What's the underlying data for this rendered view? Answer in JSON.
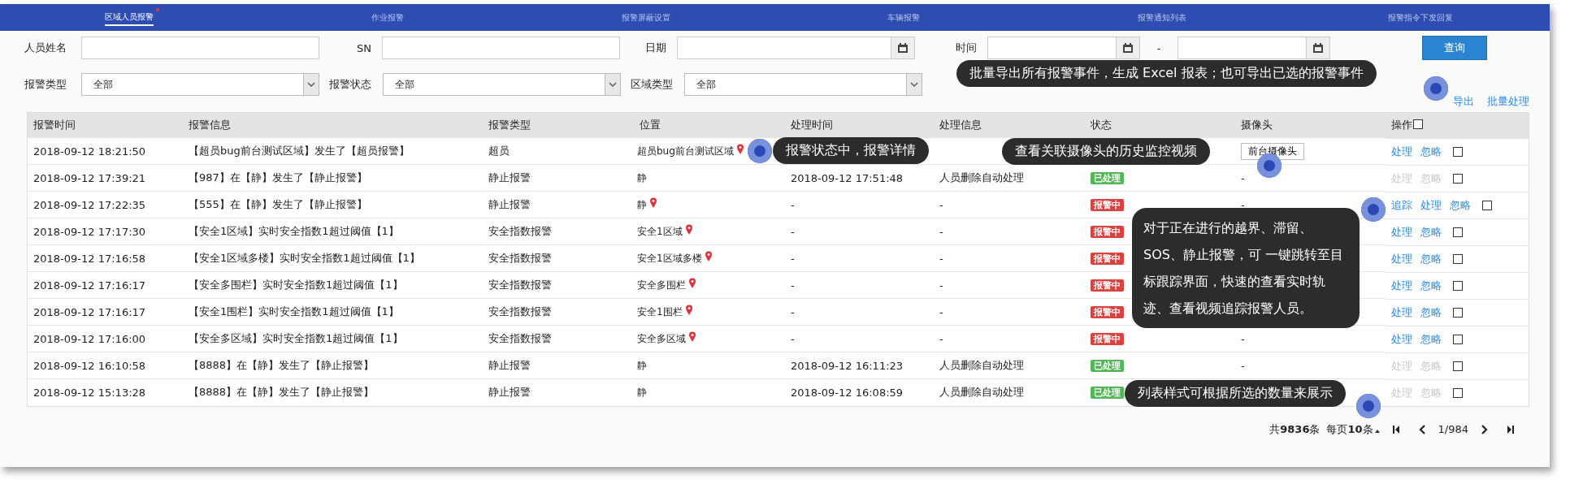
{
  "nav_tabs": [
    {
      "label": "区域人员报警",
      "selected": true,
      "dot": true
    },
    {
      "label": "作业报警",
      "selected": false,
      "dot": false
    },
    {
      "label": "报警屏蔽设置",
      "selected": false,
      "dot": false
    },
    {
      "label": "车辆报警",
      "selected": false,
      "dot": false
    },
    {
      "label": "报警通知列表",
      "selected": false,
      "dot": false
    },
    {
      "label": "报警指令下发回复",
      "selected": false,
      "dot": false
    }
  ],
  "filters": [
    {
      "kind": "text",
      "label": "人员姓名"
    },
    {
      "kind": "text",
      "label": "SN"
    },
    {
      "kind": "date",
      "label": "日期"
    },
    {
      "kind": "range",
      "label": "时间",
      "separator": "-"
    }
  ],
  "search_button": "查询",
  "selects": [
    {
      "label": "报警类型",
      "value": "全部"
    },
    {
      "label": "报警状态",
      "value": "全部"
    },
    {
      "label": "区域类型",
      "value": "全部"
    }
  ],
  "toolbar_links": [
    "导出",
    "批量处理"
  ],
  "table": {
    "columns": [
      "报警时间",
      "报警信息",
      "报警类型",
      "位置",
      "处理时间",
      "处理信息",
      "状态",
      "摄像头",
      "操作"
    ],
    "select_all": {
      "checked": false
    },
    "rows": [
      {
        "time": "2018-09-12 18:21:50",
        "info": "【超员bug前台测试区域】发生了【超员报警】",
        "type": "超员",
        "location": "超员bug前台测试区域",
        "pin": true,
        "camera": {
          "kind": "button",
          "label": "前台摄像头"
        },
        "actions": [
          {
            "label": "处理",
            "disabled": false
          },
          {
            "label": "忽略",
            "disabled": false
          }
        ],
        "checked": false
      },
      {
        "time": "2018-09-12 17:39:21",
        "info": "【987】在【静】发生了【静止报警】",
        "type": "静止报警",
        "location": "静",
        "pin": false,
        "handled_time": "2018-09-12 17:51:48",
        "handle_info": "人员删除自动处理",
        "status": {
          "kind": "handled",
          "label": "已处理"
        },
        "camera": {
          "kind": "text",
          "label": "-"
        },
        "actions": [
          {
            "label": "处理",
            "disabled": true
          },
          {
            "label": "忽略",
            "disabled": true
          }
        ],
        "checked": false
      },
      {
        "time": "2018-09-12 17:22:35",
        "info": "【555】在【静】发生了【静止报警】",
        "type": "静止报警",
        "location": "静",
        "pin": true,
        "handled_time": "-",
        "handle_info": "-",
        "status": {
          "kind": "alarming",
          "label": "报警中"
        },
        "camera": {
          "kind": "text",
          "label": "-"
        },
        "actions": [
          {
            "label": "追踪",
            "disabled": false
          },
          {
            "label": "处理",
            "disabled": false
          },
          {
            "label": "忽略",
            "disabled": false
          }
        ],
        "checked": false
      },
      {
        "time": "2018-09-12 17:17:30",
        "info": "【安全1区域】实时安全指数1超过阈值【1】",
        "type": "安全指数报警",
        "location": "安全1区域",
        "pin": true,
        "handled_time": "-",
        "handle_info": "-",
        "status": {
          "kind": "alarming",
          "label": "报警中"
        },
        "actions": [
          {
            "label": "处理",
            "disabled": false
          },
          {
            "label": "忽略",
            "disabled": false
          }
        ],
        "checked": false
      },
      {
        "time": "2018-09-12 17:16:58",
        "info": "【安全1区域多楼】实时安全指数1超过阈值【1】",
        "type": "安全指数报警",
        "location": "安全1区域多楼",
        "pin": true,
        "handled_time": "-",
        "handle_info": "-",
        "status": {
          "kind": "alarming",
          "label": "报警中"
        },
        "actions": [
          {
            "label": "处理",
            "disabled": false
          },
          {
            "label": "忽略",
            "disabled": false
          }
        ],
        "checked": false
      },
      {
        "time": "2018-09-12 17:16:17",
        "info": "【安全多围栏】实时安全指数1超过阈值【1】",
        "type": "安全指数报警",
        "location": "安全多围栏",
        "pin": true,
        "handled_time": "-",
        "handle_info": "-",
        "status": {
          "kind": "alarming",
          "label": "报警中"
        },
        "actions": [
          {
            "label": "处理",
            "disabled": false
          },
          {
            "label": "忽略",
            "disabled": false
          }
        ],
        "checked": false
      },
      {
        "time": "2018-09-12 17:16:17",
        "info": "【安全1围栏】实时安全指数1超过阈值【1】",
        "type": "安全指数报警",
        "location": "安全1围栏",
        "pin": true,
        "handled_time": "-",
        "handle_info": "-",
        "status": {
          "kind": "alarming",
          "label": "报警中"
        },
        "actions": [
          {
            "label": "处理",
            "disabled": false
          },
          {
            "label": "忽略",
            "disabled": false
          }
        ],
        "checked": false
      },
      {
        "time": "2018-09-12 17:16:00",
        "info": "【安全多区域】实时安全指数1超过阈值【1】",
        "type": "安全指数报警",
        "location": "安全多区域",
        "pin": true,
        "handled_time": "-",
        "handle_info": "-",
        "status": {
          "kind": "alarming",
          "label": "报警中"
        },
        "camera": {
          "kind": "text",
          "label": "-"
        },
        "actions": [
          {
            "label": "处理",
            "disabled": false
          },
          {
            "label": "忽略",
            "disabled": false
          }
        ],
        "checked": false
      },
      {
        "time": "2018-09-12 16:10:58",
        "info": "【8888】在【静】发生了【静止报警】",
        "type": "静止报警",
        "location": "静",
        "pin": false,
        "handled_time": "2018-09-12 16:11:23",
        "handle_info": "人员删除自动处理",
        "status": {
          "kind": "handled",
          "label": "已处理"
        },
        "camera": {
          "kind": "text",
          "label": "-"
        },
        "actions": [
          {
            "label": "处理",
            "disabled": true
          },
          {
            "label": "忽略",
            "disabled": true
          }
        ],
        "checked": false
      },
      {
        "time": "2018-09-12 15:13:28",
        "info": "【8888】在【静】发生了【静止报警】",
        "type": "静止报警",
        "location": "静",
        "pin": false,
        "handled_time": "2018-09-12 16:08:59",
        "handle_info": "人员删除自动处理",
        "status": {
          "kind": "handled",
          "label": "已处理"
        },
        "actions": [
          {
            "label": "处理",
            "disabled": true
          },
          {
            "label": "忽略",
            "disabled": true
          }
        ],
        "checked": false
      }
    ]
  },
  "pagination": {
    "total": "共**9836**条",
    "page_size": "每页**10**条",
    "page": "1/984"
  },
  "callouts": [
    {
      "text": "批量导出所有报警事件，生成 Excel 报表；也可导出已选的报警事件"
    },
    {
      "text": "报警状态中，报警详情"
    },
    {
      "text": "查看关联摄像头的历史监控视频"
    },
    {
      "text": "对于正在进行的越界、滞留、SOS、静止报警，可 一键跳转至目标跟踪界面，快速的查看实时轨迹、查看视频追踪报警人员。"
    },
    {
      "text": "列表样式可根据所选的数量来展示"
    }
  ]
}
